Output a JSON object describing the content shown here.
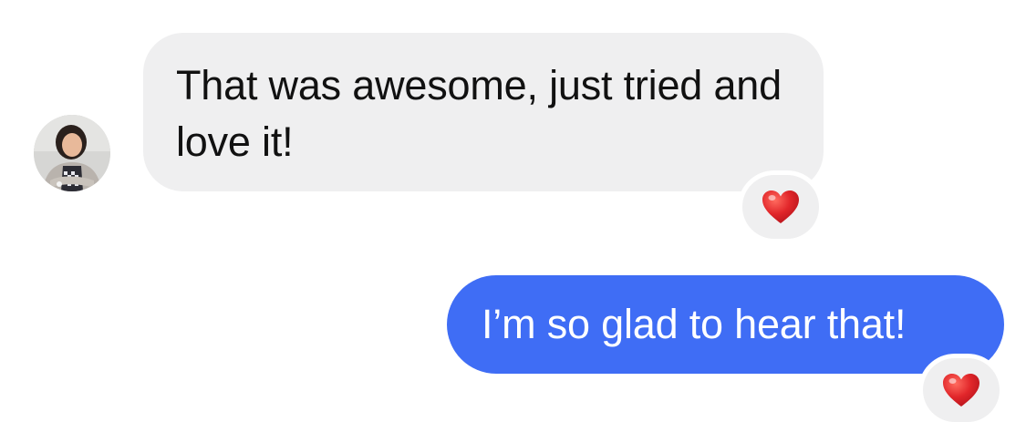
{
  "conversation": {
    "incoming": {
      "text": "That was awesome, just tried and love it!",
      "reaction": "heart-emoji"
    },
    "outgoing": {
      "text": "I’m so glad to hear that!",
      "reaction": "heart-emoji"
    }
  },
  "colors": {
    "incoming_bubble": "#efeff0",
    "outgoing_bubble": "#3f6df5",
    "heart": "#e1262a"
  }
}
